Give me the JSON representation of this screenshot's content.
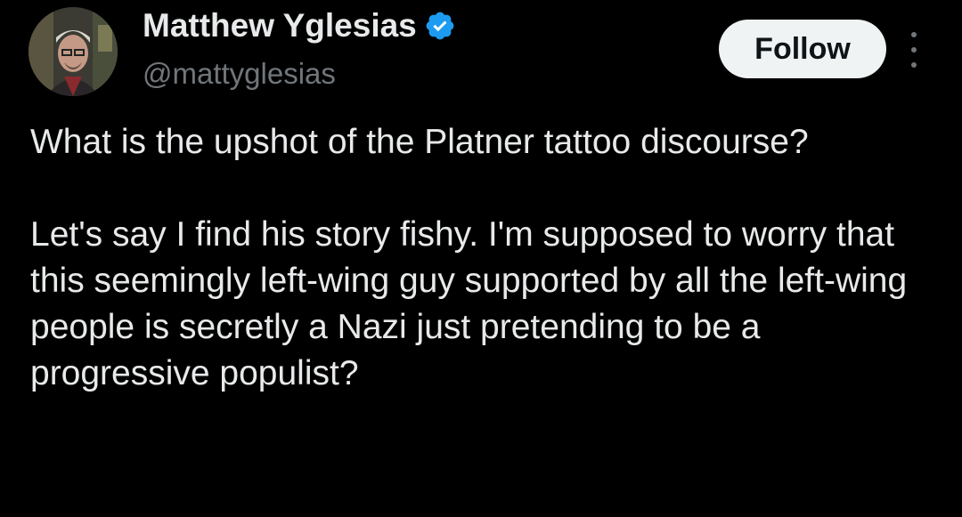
{
  "author": {
    "display_name": "Matthew Yglesias",
    "handle": "@mattyglesias",
    "verified": true,
    "verified_color": "#1d9bf0"
  },
  "actions": {
    "follow_label": "Follow"
  },
  "tweet": {
    "paragraphs": [
      "What is the upshot of the Platner tattoo discourse?",
      "Let's say I find his story fishy. I'm supposed to worry that this seemingly left-wing guy supported by all the left-wing people is secretly a Nazi just pretending to be a progressive populist?"
    ]
  },
  "theme": {
    "background": "#000000",
    "text": "#e7e9ea",
    "secondary_text": "#71767b",
    "button_bg": "#eff3f4"
  }
}
